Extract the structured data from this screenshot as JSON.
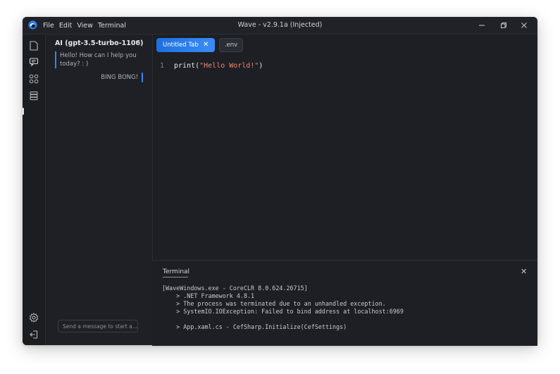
{
  "window": {
    "title": "Wave - v2.9.1a (Injected)"
  },
  "menu": [
    "File",
    "Edit",
    "View",
    "Terminal"
  ],
  "activity_icons": [
    "file-icon",
    "chat-icon",
    "grid-icon",
    "database-icon",
    "settings-icon",
    "logout-icon"
  ],
  "ai_panel": {
    "title": "AI (gpt-3.5-turbo-1106)",
    "more": "···",
    "messages": [
      {
        "role": "ai",
        "text": "Hello! How can I help you today? : )"
      },
      {
        "role": "user",
        "text": "BING BONG!"
      }
    ],
    "input_placeholder": "Send a message to start a..."
  },
  "tabs": [
    {
      "label": "Untitled Tab",
      "active": true,
      "close": "✕"
    },
    {
      "label": ".env",
      "active": false
    }
  ],
  "editor": {
    "line_number": "1",
    "code_func": "print(",
    "code_string": "\"Hello World!\"",
    "code_end": ")"
  },
  "terminal": {
    "title": "Terminal",
    "close": "✕",
    "lines": [
      "[WaveWindows.exe - CoreCLR 8.0.624.26715]",
      "    > .NET Framework 4.8.1",
      "    > The process was terminated due to an unhandled exception.",
      "    > SystemIO.IOException: Failed to bind address at localhost:6969",
      "",
      "    > App.xaml.cs - CefSharp.Initialize(CefSettings)"
    ]
  },
  "colors": {
    "accent": "#3a82f6",
    "background": "#1d1f24",
    "string": "#f08770"
  }
}
